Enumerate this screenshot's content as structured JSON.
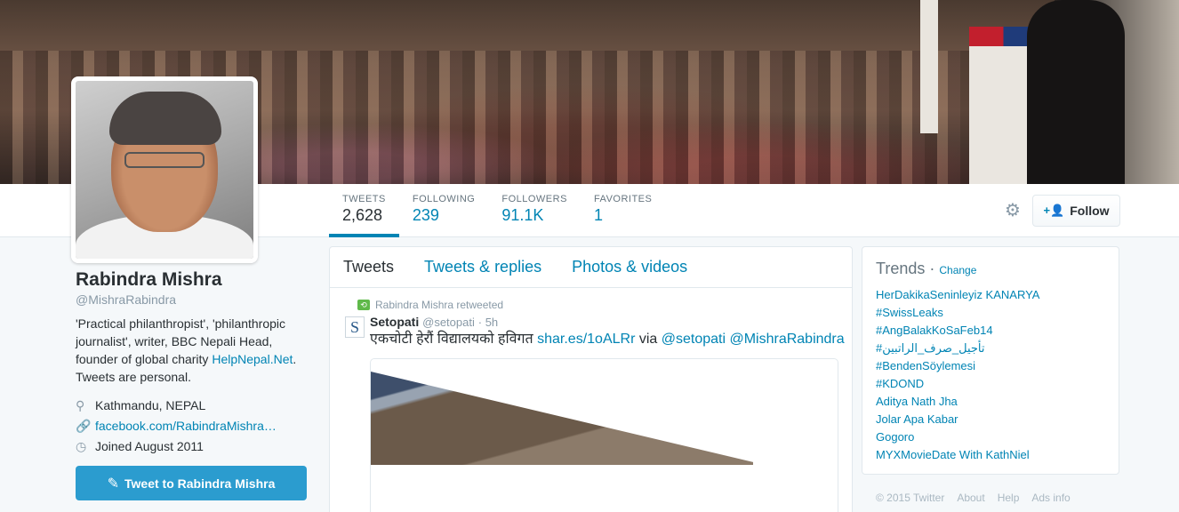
{
  "stats": [
    {
      "label": "TWEETS",
      "value": "2,628"
    },
    {
      "label": "FOLLOWING",
      "value": "239"
    },
    {
      "label": "FOLLOWERS",
      "value": "91.1K"
    },
    {
      "label": "FAVORITES",
      "value": "1"
    }
  ],
  "follow_label": "Follow",
  "profile": {
    "name": "Rabindra Mishra",
    "handle": "@MishraRabindra",
    "bio_text": "'Practical philanthropist', 'philanthropic journalist', writer, BBC Nepali Head, founder of global charity ",
    "bio_link": "HelpNepal.Net",
    "bio_after": ". Tweets are personal.",
    "location": "Kathmandu, NEPAL",
    "website": "facebook.com/RabindraMishra…",
    "joined": "Joined August 2011",
    "tweet_to": "Tweet to Rabindra Mishra"
  },
  "timeline": {
    "tabs": [
      "Tweets",
      "Tweets & replies",
      "Photos & videos"
    ],
    "tweet": {
      "retweet_note": "Rabindra Mishra retweeted",
      "author": "Setopati",
      "handle": "@setopati",
      "time": "· 5h",
      "text": "एकचोटी हेरौं विद्यालयको हविगत ",
      "link": "shar.es/1oALRr",
      "via": " via ",
      "mention1": "@setopati",
      "mention2": "@MishraRabindra",
      "avatar_letter": "S"
    }
  },
  "trends": {
    "title": "Trends",
    "change": "Change",
    "items": [
      "HerDakikaSeninleyiz KANARYA",
      "#SwissLeaks",
      "#AngBalakKoSaFeb14",
      "#تأجيل_صرف_الراتبين",
      "#BendenSöylemesi",
      "#KDOND",
      "Aditya Nath Jha",
      "Jolar Apa Kabar",
      "Gogoro",
      "MYXMovieDate With KathNiel"
    ]
  },
  "footer": [
    "© 2015 Twitter",
    "About",
    "Help",
    "Ads info"
  ]
}
